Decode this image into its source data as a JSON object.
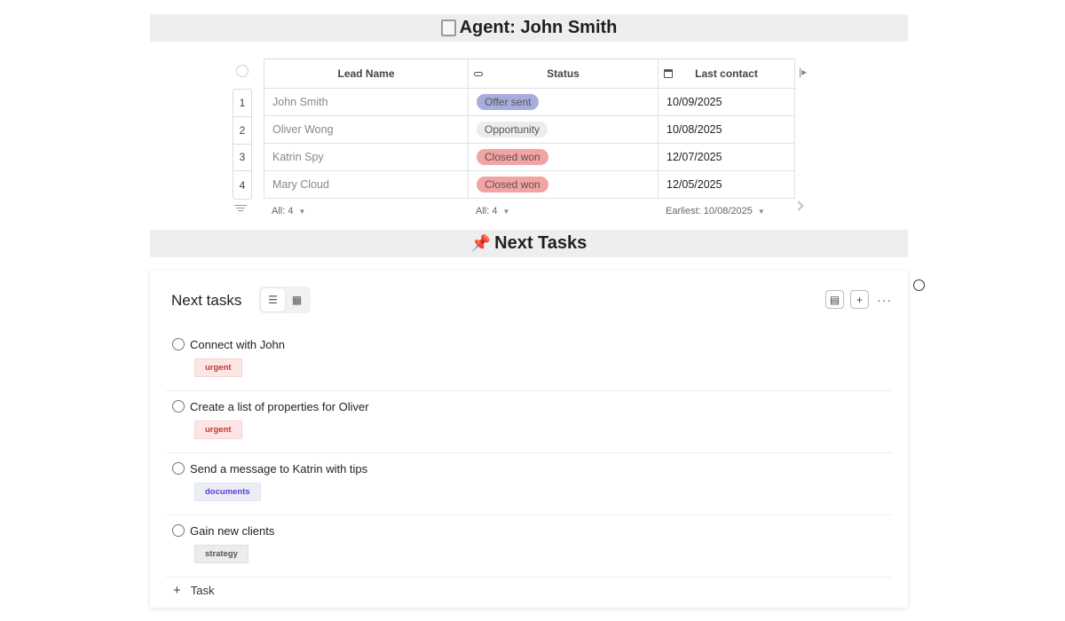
{
  "banner_agent": {
    "emoji": "document",
    "title": "Agent: John Smith"
  },
  "table": {
    "headers": {
      "name": "Lead Name",
      "status": "Status",
      "last_contact": "Last contact"
    },
    "rows": [
      {
        "num": "1",
        "name": "John Smith",
        "status": "Offer sent",
        "status_color": "#a6acdd",
        "date": "10/09/2025"
      },
      {
        "num": "2",
        "name": "Oliver Wong",
        "status": "Opportunity",
        "status_color": "#ececec",
        "date": "10/08/2025"
      },
      {
        "num": "3",
        "name": "Katrin Spy",
        "status": "Closed won",
        "status_color": "#f4a3a3",
        "date": "12/07/2025"
      },
      {
        "num": "4",
        "name": "Mary Cloud",
        "status": "Closed won",
        "status_color": "#f4a3a3",
        "date": "12/05/2025"
      }
    ],
    "footer": {
      "name_count": "All: 4",
      "status_count": "All: 4",
      "date_summary": "Earliest: 10/08/2025"
    }
  },
  "banner_tasks": {
    "emoji": "📌",
    "title": "Next Tasks"
  },
  "tasks_card": {
    "title": "Next tasks",
    "tasks": [
      {
        "label": "Connect with John",
        "tag": "urgent"
      },
      {
        "label": "Create a list of properties for Oliver",
        "tag": "urgent"
      },
      {
        "label": "Send a message to Katrin with tips",
        "tag": "documents"
      },
      {
        "label": "Gain new clients",
        "tag": "strategy"
      }
    ],
    "add_label": "Task",
    "add_symbol": "+"
  }
}
